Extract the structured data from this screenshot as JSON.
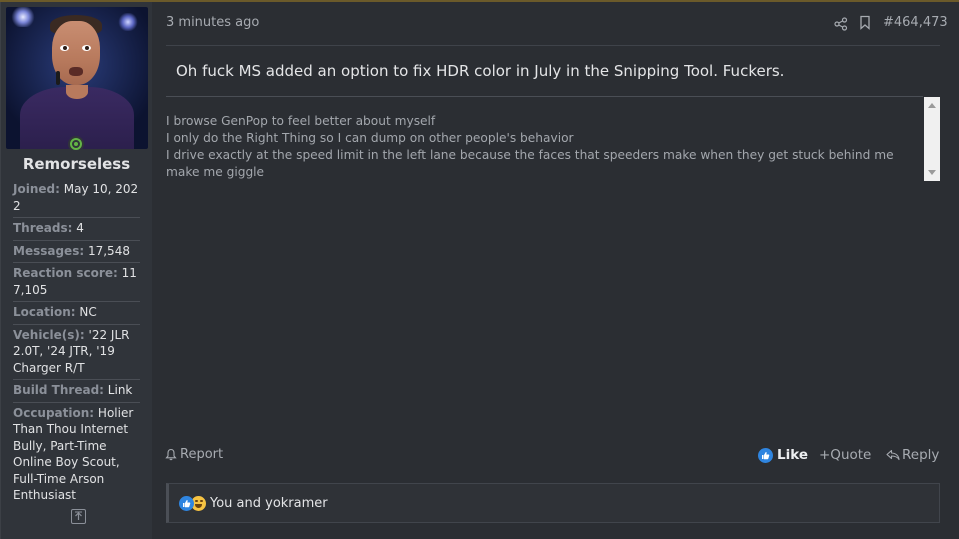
{
  "post": {
    "time": "3 minutes ago",
    "number": "#464,473",
    "message": "Oh fuck MS added an option to fix HDR color in July in the Snipping Tool. Fuckers."
  },
  "user": {
    "name": "Remorseless",
    "status": "online",
    "stats": [
      {
        "label": "Joined:",
        "value": "May 10, 2022"
      },
      {
        "label": "Threads:",
        "value": "4"
      },
      {
        "label": "Messages:",
        "value": "17,548"
      },
      {
        "label": "Reaction score:",
        "value": "117,105"
      },
      {
        "label": "Location:",
        "value": "NC"
      },
      {
        "label": "Vehicle(s):",
        "value": "'22 JLR 2.0T, '24 JTR, '19 Charger R/T"
      },
      {
        "label": "Build Thread:",
        "value": "Link"
      },
      {
        "label": "Occupation:",
        "value": "Holier Than Thou Internet Bully, Part-Time Online Boy Scout, Full-Time Arson Enthusiast"
      }
    ]
  },
  "signature": {
    "lines": [
      "I browse GenPop to feel better about myself",
      "I only do the Right Thing so I can dump on other people's behavior",
      "I drive exactly at the speed limit in the left lane because the faces that speeders make when they get stuck behind me make me giggle"
    ]
  },
  "actions": {
    "report": "Report",
    "like": "Like",
    "quote": "+Quote",
    "reply": "Reply"
  },
  "reactions": {
    "text": "You and yokramer",
    "icons": [
      "like-reaction-icon",
      "haha-reaction-icon"
    ]
  },
  "colors": {
    "background": "#2b2e33",
    "sidebar": "#30343a",
    "like_blue": "#2f85e0",
    "online_green": "#63b446"
  }
}
